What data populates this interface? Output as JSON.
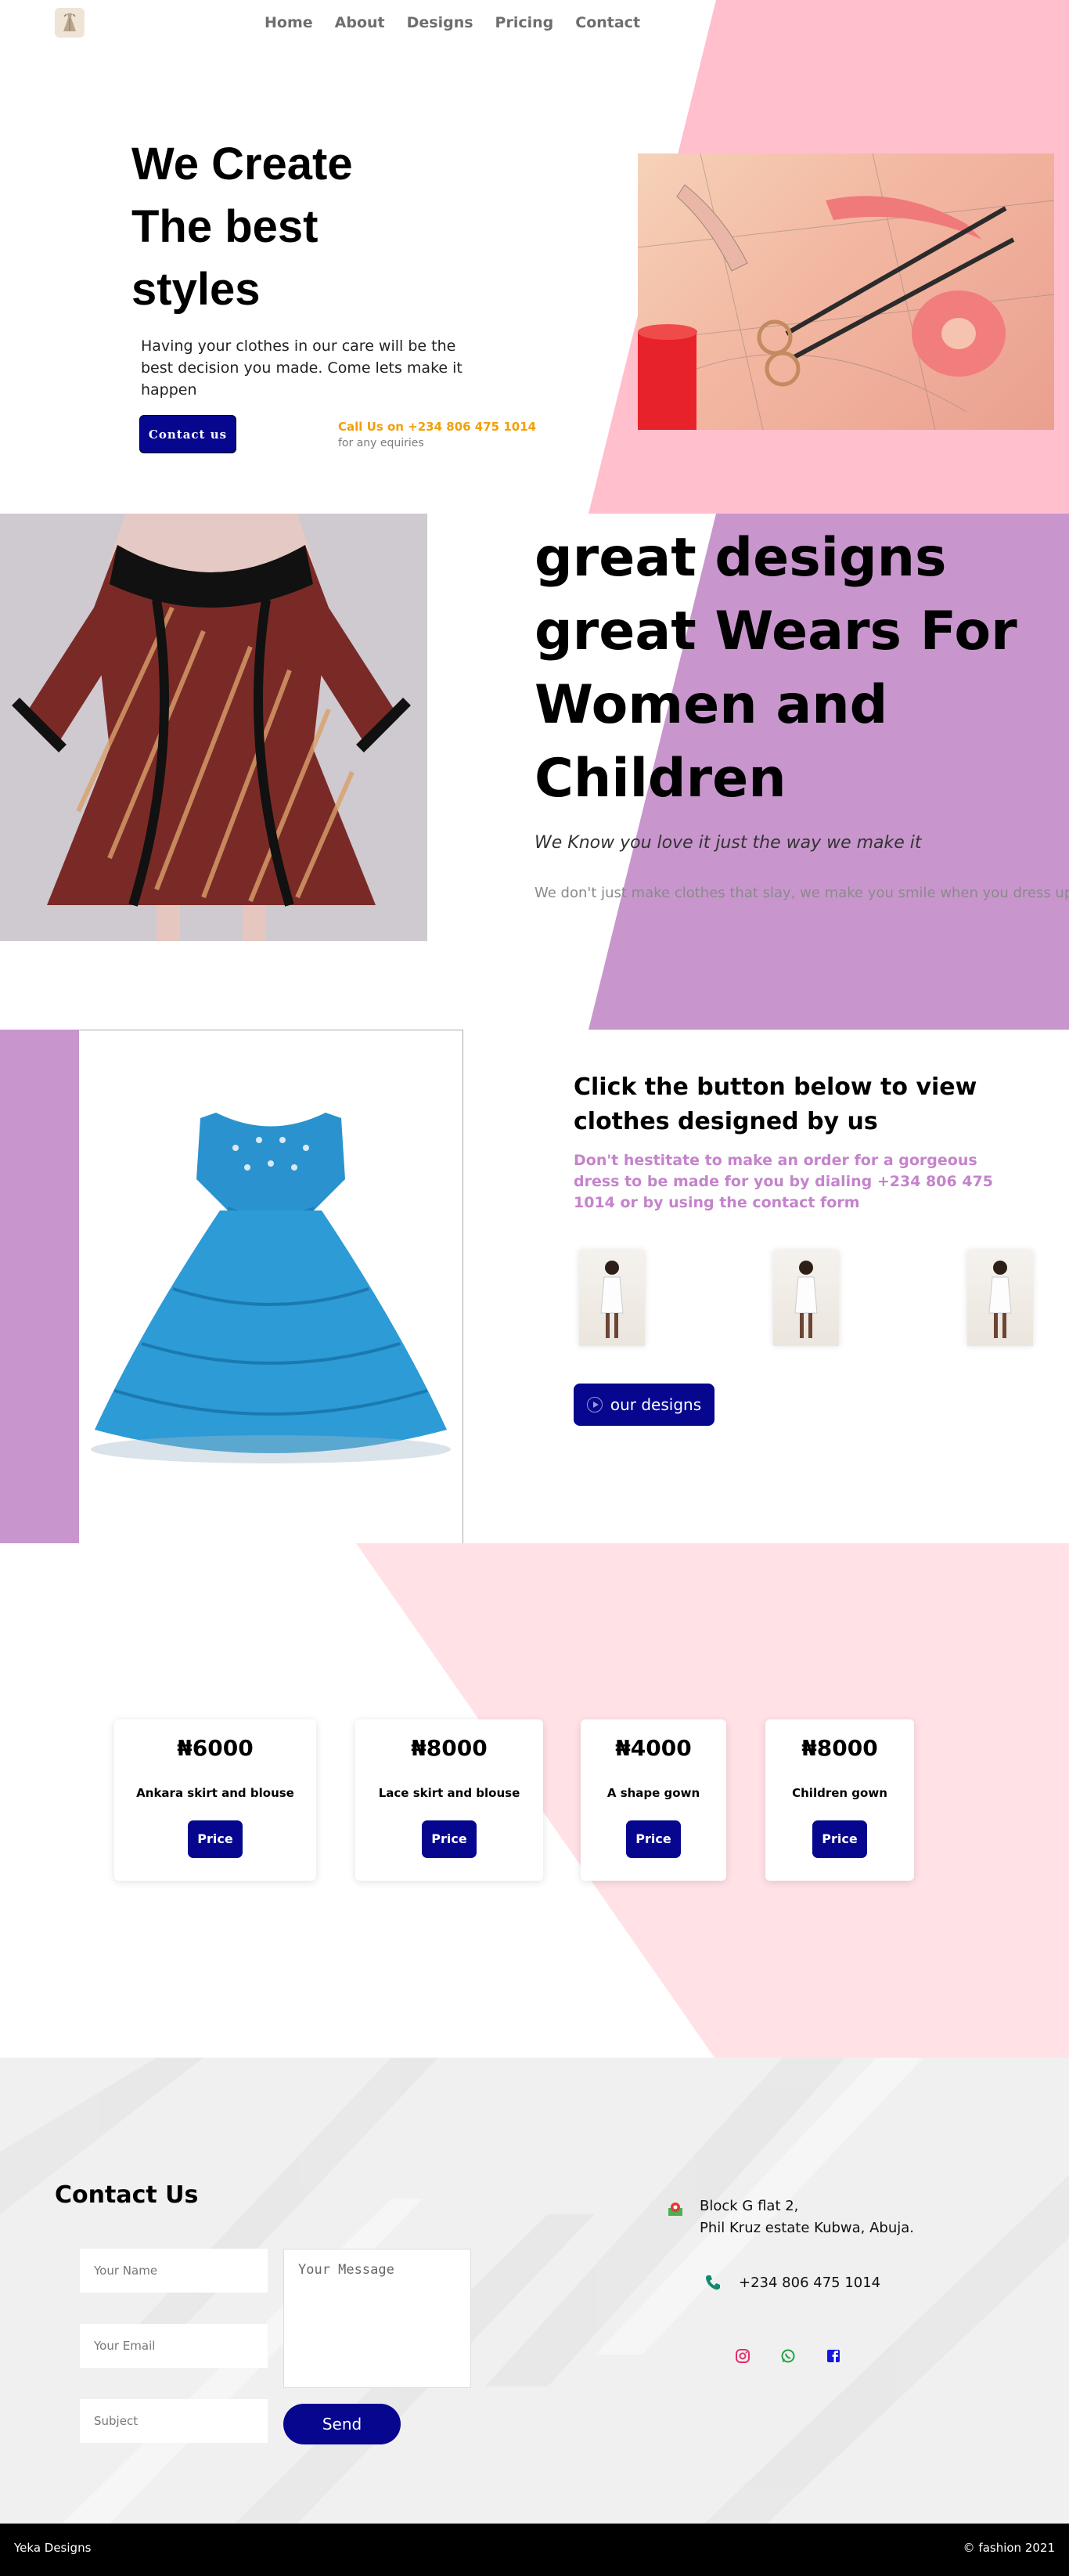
{
  "nav": {
    "logo_icon": "dress-logo-icon",
    "links": [
      "Home",
      "About",
      "Designs",
      "Pricing",
      "Contact"
    ]
  },
  "hero": {
    "title": "We Create The best styles",
    "subtitle": "Having your clothes in our care will be the best decision you made. Come lets make it happen",
    "contact_button": "Contact us",
    "call_us": "Call Us on +234 806 475 1014",
    "call_sub": "for any equiries",
    "bg_color": "#ffbfcd",
    "photo_icon": "tailoring-tools-photo"
  },
  "section2": {
    "title": "great designs great Wears For Women and Children",
    "tagline": "We Know you love it just the way we make it",
    "description": "We don't just make clothes that slay, we make you smile when you dress up",
    "bg_color": "#c896cd",
    "photo_icon": "ankara-dress-photo"
  },
  "section3": {
    "title": "Click the button below to view clothes designed by us",
    "text": "Don't hestitate to make an order for a gorgeous dress to be made for you by dialing +234 806 475 1014 or by using the contact form",
    "button": "our designs",
    "strip_color": "#c896cd",
    "thumbnails": [
      "model-photo",
      "model-photo",
      "model-photo"
    ]
  },
  "pricing": {
    "bg_color": "#ffe1e6",
    "cards": [
      {
        "price": "₦6000",
        "name": "Ankara skirt and blouse",
        "button": "Price"
      },
      {
        "price": "₦8000",
        "name": "Lace skirt and blouse",
        "button": "Price"
      },
      {
        "price": "₦4000",
        "name": "A shape gown",
        "button": "Price"
      },
      {
        "price": "₦8000",
        "name": "Children gown",
        "button": "Price"
      }
    ]
  },
  "contact": {
    "title": "Contact Us",
    "name_placeholder": "Your Name",
    "email_placeholder": "Your Email",
    "subject_placeholder": "Subject",
    "message_placeholder": "Your Message",
    "send_button": "Send",
    "address_line1": "Block G flat 2,",
    "address_line2": "Phil Kruz estate Kubwa, Abuja.",
    "phone": "+234 806 475 1014",
    "social": [
      "instagram-icon",
      "whatsapp-icon",
      "facebook-icon"
    ]
  },
  "footer": {
    "brand": "Yeka Designs",
    "copyright": "© fashion 2021"
  }
}
